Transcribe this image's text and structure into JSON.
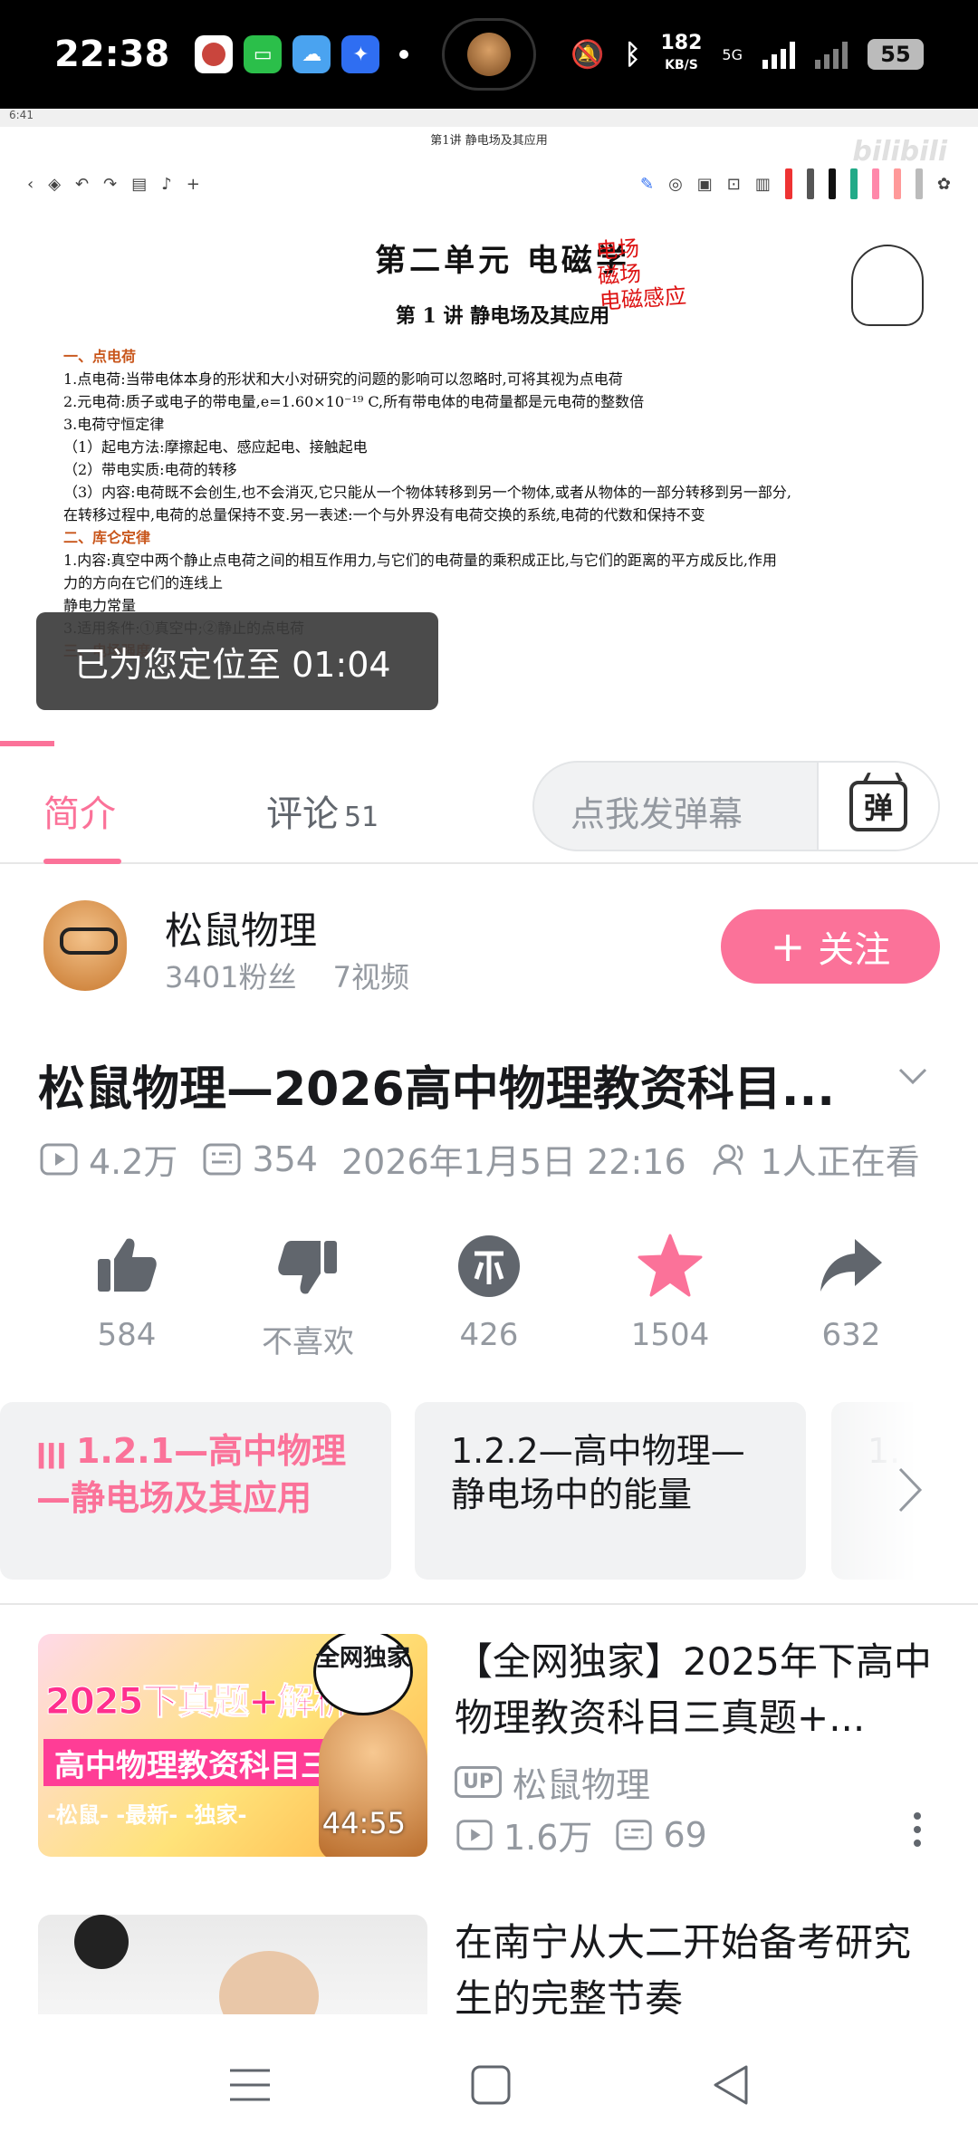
{
  "status_bar": {
    "time": "22:38",
    "speed_value": "182",
    "speed_unit": "KB/S",
    "network": "5G",
    "battery": "55"
  },
  "video": {
    "inner_time": "6:41",
    "doc_title": "第1讲 静电场及其应用",
    "unit_title": "第二单元 电磁学",
    "lecture_title": "第 1 讲 静电场及其应用",
    "handwriting": [
      "电场",
      "磁场",
      "电磁感应"
    ],
    "notes": [
      {
        "cls": "sec",
        "text": "一、点电荷"
      },
      {
        "cls": "",
        "text": "1.点电荷:当带电体本身的形状和大小对研究的问题的影响可以忽略时,可将其视为点电荷"
      },
      {
        "cls": "",
        "text": "2.元电荷:质子或电子的带电量,e=1.60×10⁻¹⁹ C,所有带电体的电荷量都是元电荷的整数倍"
      },
      {
        "cls": "",
        "text": "3.电荷守恒定律"
      },
      {
        "cls": "",
        "text": "（1）起电方法:摩擦起电、感应起电、接触起电"
      },
      {
        "cls": "",
        "text": "（2）带电实质:电荷的转移"
      },
      {
        "cls": "",
        "text": "（3）内容:电荷既不会创生,也不会消灭,它只能从一个物体转移到另一个物体,或者从物体的一部分转移到另一部分,"
      },
      {
        "cls": "",
        "text": "在转移过程中,电荷的总量保持不变.另一表述:一个与外界没有电荷交换的系统,电荷的代数和保持不变"
      },
      {
        "cls": "sec",
        "text": "二、库仑定律"
      },
      {
        "cls": "",
        "text": "1.内容:真空中两个静止点电荷之间的相互作用力,与它们的电荷量的乘积成正比,与它们的距离的平方成反比,作用"
      },
      {
        "cls": "",
        "text": "力的方向在它们的连线上"
      },
      {
        "cls": "",
        "text": "                                                              静电力常量"
      },
      {
        "cls": "",
        "text": "3.适用条件:①真空中;②静止的点电荷"
      },
      {
        "cls": "sec",
        "text": "三、电场强度"
      }
    ],
    "toast": "已为您定位至 01:04",
    "watermark": "bilibili"
  },
  "tabs": {
    "intro": "简介",
    "comments": "评论",
    "comments_count": "51",
    "danmaku_placeholder": "点我发弹幕",
    "danmaku_icon": "弹"
  },
  "uploader": {
    "name": "松鼠物理",
    "fans": "3401粉丝",
    "videos": "7视频",
    "follow_label": "关注"
  },
  "video_info": {
    "title": "松鼠物理—2026高中物理教资科目...",
    "views": "4.2万",
    "danmaku": "354",
    "date": "2026年1月5日 22:16",
    "watching": "1人正在看"
  },
  "actions": [
    {
      "icon": "like-icon",
      "label": "584"
    },
    {
      "icon": "dislike-icon",
      "label": "不喜欢"
    },
    {
      "icon": "coin-icon",
      "label": "426"
    },
    {
      "icon": "favorite-icon",
      "label": "1504"
    },
    {
      "icon": "share-icon",
      "label": "632"
    }
  ],
  "episodes": [
    {
      "title": "1.2.1—高中物理—静电场及其应用",
      "active": true
    },
    {
      "title": "1.2.2—高中物理—静电场中的能量",
      "active": false
    },
    {
      "title": "1.",
      "active": false
    }
  ],
  "recommended": [
    {
      "thumb_line1": "2025下真题+解析",
      "thumb_line2": "高中物理教资科目三",
      "thumb_line3": "-松鼠- -最新- -独家-",
      "thumb_bubble": "全网独家",
      "duration": "44:55",
      "title": "【全网独家】2025年下高中物理教资科目三真题+...",
      "uploader": "松鼠物理",
      "up_badge": "UP",
      "views": "1.6万",
      "danmaku": "69"
    },
    {
      "title": "在南宁从大二开始备考研究生的完整节奏"
    }
  ],
  "colors": {
    "accent": "#fb7299",
    "text_primary": "#18191c",
    "text_secondary": "#9499a0"
  }
}
